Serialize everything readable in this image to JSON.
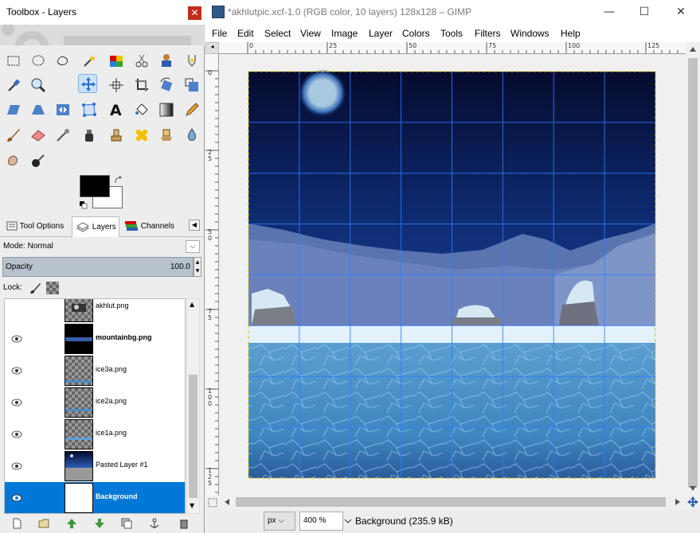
{
  "toolbox": {
    "title": "Toolbox - Layers",
    "close": "✕",
    "tools": [
      {
        "name": "rect-select-icon"
      },
      {
        "name": "ellipse-select-icon"
      },
      {
        "name": "free-select-icon"
      },
      {
        "name": "fuzzy-select-icon"
      },
      {
        "name": "color-select-icon"
      },
      {
        "name": "scissors-icon"
      },
      {
        "name": "foreground-select-icon"
      },
      {
        "name": "paths-icon"
      },
      {
        "name": "color-picker-icon"
      },
      {
        "name": "zoom-icon"
      },
      {
        "name": "move-icon"
      },
      {
        "name": "align-icon"
      },
      {
        "name": "crop-icon"
      },
      {
        "name": "rotate-icon"
      },
      {
        "name": "scale-icon"
      },
      {
        "name": "shear-icon"
      },
      {
        "name": "perspective-icon"
      },
      {
        "name": "flip-icon"
      },
      {
        "name": "cage-transform-icon"
      },
      {
        "name": "text-icon"
      },
      {
        "name": "bucket-fill-icon"
      },
      {
        "name": "blend-icon"
      },
      {
        "name": "pencil-icon"
      },
      {
        "name": "paintbrush-icon"
      },
      {
        "name": "eraser-icon"
      },
      {
        "name": "airbrush-icon"
      },
      {
        "name": "ink-icon"
      },
      {
        "name": "clone-icon"
      },
      {
        "name": "heal-icon"
      },
      {
        "name": "perspective-clone-icon"
      },
      {
        "name": "blur-icon"
      },
      {
        "name": "smudge-icon"
      },
      {
        "name": "dodge-burn-icon"
      }
    ],
    "tabs": [
      {
        "label": "Tool Options"
      },
      {
        "label": "Layers"
      },
      {
        "label": "Channels"
      }
    ],
    "dock_menu": "◀",
    "mode_label": "Mode: Normal",
    "mode_chevron": "⌵",
    "opacity_label": "Opacity",
    "opacity_value": "100.0",
    "lock_label": "Lock:",
    "layers": [
      {
        "name": "akhlut.png",
        "bold": false,
        "selected": false
      },
      {
        "name": "mountainbg.png",
        "bold": true,
        "selected": false
      },
      {
        "name": "ice3a.png",
        "bold": false,
        "selected": false
      },
      {
        "name": "ice2a.png",
        "bold": false,
        "selected": false
      },
      {
        "name": "ice1a.png",
        "bold": false,
        "selected": false
      },
      {
        "name": "Pasted Layer #1",
        "bold": false,
        "selected": false
      },
      {
        "name": "Background",
        "bold": true,
        "selected": true
      }
    ],
    "scroll_up": "▲",
    "scroll_down": "▼"
  },
  "image_window": {
    "title": "*akhlutpic.xcf-1.0 (RGB color, 10 layers) 128x128 – GIMP",
    "minimize": "—",
    "maximize": "☐",
    "close": "✕",
    "menus": [
      "File",
      "Edit",
      "Select",
      "View",
      "Image",
      "Layer",
      "Colors",
      "Tools",
      "Filters",
      "Windows",
      "Help"
    ],
    "ruler_corner": "◂",
    "hruler_labels": [
      "0",
      "25",
      "50",
      "75",
      "100",
      "125"
    ],
    "vruler_labels": [
      "0",
      "2\n5",
      "5\n0",
      "7\n5",
      "1\n0\n0",
      "1\n2\n5"
    ],
    "unit": "px",
    "zoom": "400 %",
    "status": "Background (235.9 kB)"
  },
  "colors": {
    "accent": "#0078d7",
    "sky_top": "#050b2e",
    "sky_bottom": "#1c47a0",
    "ice": "#3d86bf",
    "snow": "#e3f1fb",
    "grid": "#2f7cff"
  }
}
